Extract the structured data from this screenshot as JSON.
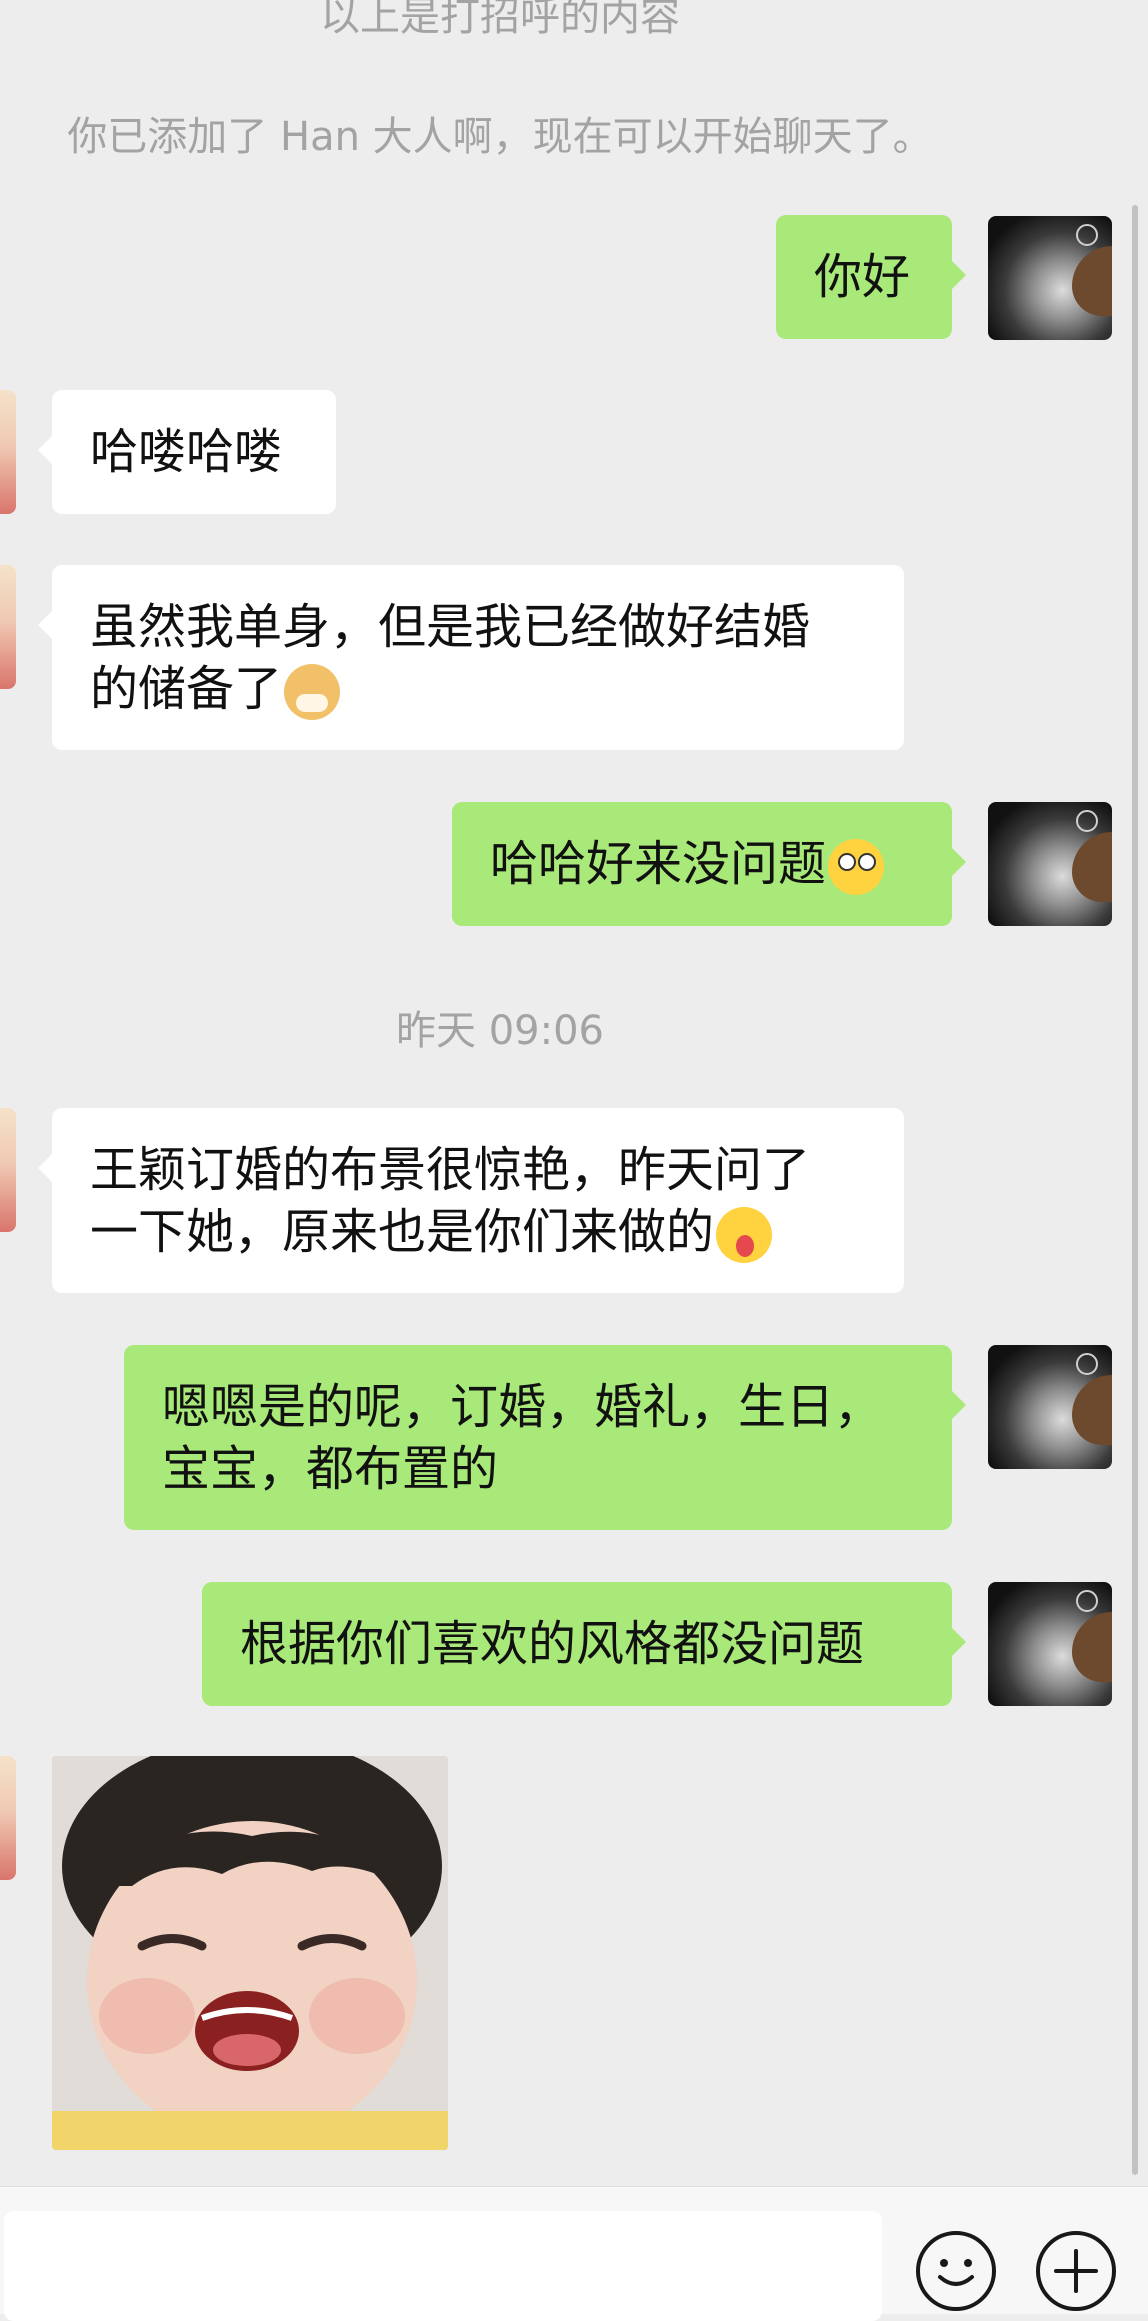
{
  "system": {
    "greeting_header": "以上是打招呼的内容",
    "added_notice": "你已添加了 Han 大人啊，现在可以开始聊天了。",
    "timestamp": "昨天 09:06"
  },
  "messages": [
    {
      "side": "right",
      "text": "你好"
    },
    {
      "side": "left",
      "text": "哈喽哈喽"
    },
    {
      "side": "left",
      "text_line1": "虽然我单身，但是我已经做好结婚",
      "text_line2": "的储备了",
      "emoji": "doge-emoji"
    },
    {
      "side": "right",
      "text": "哈哈好来没问题",
      "emoji": "hmm-emoji"
    },
    {
      "side": "left",
      "text_line1": "王颖订婚的布景很惊艳，昨天问了",
      "text_line2": "一下她，原来也是你们来做的",
      "emoji": "wow-emoji"
    },
    {
      "side": "right",
      "text_line1": "嗯嗯是的呢，订婚，婚礼，生日，",
      "text_line2": "宝宝，都布置的"
    },
    {
      "side": "right",
      "text": "根据你们喜欢的风格都没问题"
    },
    {
      "side": "left",
      "type": "sticker",
      "content": "baby-laughing-sticker"
    }
  ],
  "input_bar": {
    "emoji_button": "smiley-icon",
    "more_button": "plus-icon"
  },
  "colors": {
    "background": "#ededed",
    "sent_bubble": "#a9e97a",
    "received_bubble": "#ffffff",
    "system_text": "#a3a3a3"
  }
}
